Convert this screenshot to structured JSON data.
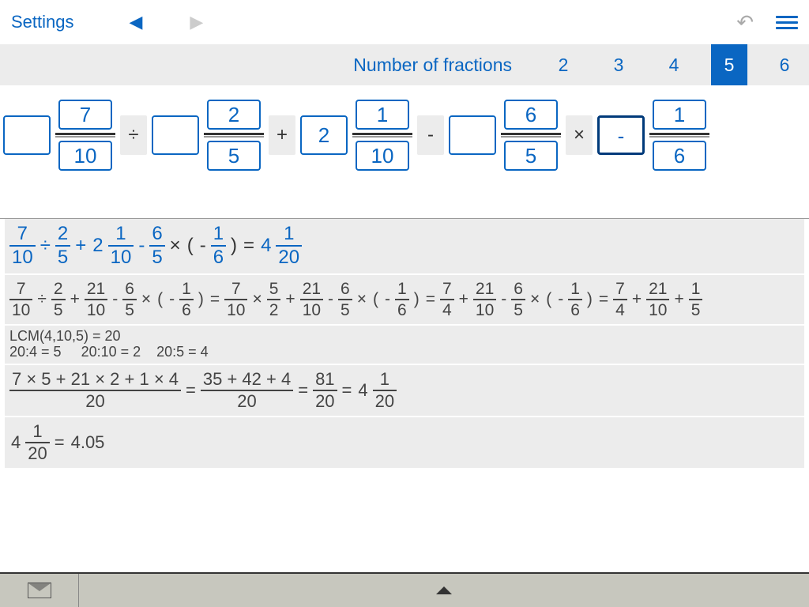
{
  "topbar": {
    "settings": "Settings",
    "prev_enabled": true,
    "next_enabled": false
  },
  "countbar": {
    "label": "Number of fractions",
    "options": [
      "2",
      "3",
      "4",
      "5",
      "6"
    ],
    "selected": "5"
  },
  "inputs": {
    "f1": {
      "whole": "",
      "num": "7",
      "den": "10"
    },
    "op1": "÷",
    "f2": {
      "whole": "",
      "num": "2",
      "den": "5"
    },
    "op2": "+",
    "f3": {
      "whole": "2",
      "num": "1",
      "den": "10"
    },
    "op3": "-",
    "f4": {
      "whole": "",
      "num": "6",
      "den": "5"
    },
    "op4": "×",
    "f5": {
      "whole": "-",
      "num": "1",
      "den": "6"
    }
  },
  "sol": {
    "line1": {
      "t1": {
        "n": "7",
        "d": "10"
      },
      "op1": "÷",
      "t2": {
        "n": "2",
        "d": "5"
      },
      "op2": "+",
      "t3w": "2",
      "t3": {
        "n": "1",
        "d": "10"
      },
      "op3": "-",
      "t4": {
        "n": "6",
        "d": "5"
      },
      "op4": "×",
      "lp": "(",
      "neg": "-",
      "t5": {
        "n": "1",
        "d": "6"
      },
      "rp": ")",
      "eq": "=",
      "rw": "4",
      "r": {
        "n": "1",
        "d": "20"
      }
    },
    "line2": {
      "segA": [
        {
          "f": {
            "n": "7",
            "d": "10"
          }
        },
        {
          "op": "÷"
        },
        {
          "f": {
            "n": "2",
            "d": "5"
          }
        },
        {
          "op": "+"
        },
        {
          "f": {
            "n": "21",
            "d": "10"
          }
        },
        {
          "op": "-"
        },
        {
          "f": {
            "n": "6",
            "d": "5"
          }
        },
        {
          "op": "×"
        },
        {
          "t": "("
        },
        {
          "t": "-"
        },
        {
          "f": {
            "n": "1",
            "d": "6"
          }
        },
        {
          "t": ")"
        },
        {
          "op": "="
        }
      ],
      "segB": [
        {
          "f": {
            "n": "7",
            "d": "10"
          }
        },
        {
          "op": "×"
        },
        {
          "f": {
            "n": "5",
            "d": "2"
          }
        },
        {
          "op": "+"
        },
        {
          "f": {
            "n": "21",
            "d": "10"
          }
        },
        {
          "op": "-"
        },
        {
          "f": {
            "n": "6",
            "d": "5"
          }
        },
        {
          "op": "×"
        },
        {
          "t": "("
        },
        {
          "t": "-"
        },
        {
          "f": {
            "n": "1",
            "d": "6"
          }
        },
        {
          "t": ")"
        },
        {
          "op": "="
        }
      ],
      "segC": [
        {
          "f": {
            "n": "7",
            "d": "4"
          }
        },
        {
          "op": "+"
        },
        {
          "f": {
            "n": "21",
            "d": "10"
          }
        },
        {
          "op": "-"
        },
        {
          "f": {
            "n": "6",
            "d": "5"
          }
        },
        {
          "op": "×"
        },
        {
          "t": "("
        },
        {
          "t": "-"
        },
        {
          "f": {
            "n": "1",
            "d": "6"
          }
        },
        {
          "t": ")"
        },
        {
          "op": "="
        }
      ],
      "segD": [
        {
          "f": {
            "n": "7",
            "d": "4"
          }
        },
        {
          "op": "+"
        },
        {
          "f": {
            "n": "21",
            "d": "10"
          }
        },
        {
          "op": "+"
        },
        {
          "f": {
            "n": "1",
            "d": "5"
          }
        }
      ]
    },
    "line3": {
      "a": "LCM(4,10,5) = 20",
      "b": "20:4 = 5     20:10 = 2    20:5 = 4"
    },
    "line4": {
      "f1": {
        "n": "7 × 5 + 21 × 2 + 1 × 4",
        "d": "20"
      },
      "eq1": "=",
      "f2": {
        "n": "35 + 42 + 4",
        "d": "20"
      },
      "eq2": "=",
      "f3": {
        "n": "81",
        "d": "20"
      },
      "eq3": "=",
      "rw": "4",
      "r": {
        "n": "1",
        "d": "20"
      }
    },
    "line5": {
      "w": "4",
      "f": {
        "n": "1",
        "d": "20"
      },
      "eq": "=",
      "dec": "4.05"
    }
  }
}
